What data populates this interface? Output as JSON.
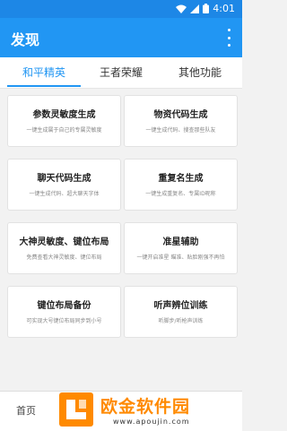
{
  "status_bar": {
    "time": "4:01"
  },
  "app_bar": {
    "title": "发现"
  },
  "tabs": [
    {
      "label": "和平精英",
      "active": true
    },
    {
      "label": "王者荣耀",
      "active": false
    },
    {
      "label": "其他功能",
      "active": false
    }
  ],
  "cards": [
    {
      "title": "参数灵敏度生成",
      "subtitle": "一键生成属于自己的专属灵敏度"
    },
    {
      "title": "物资代码生成",
      "subtitle": "一键生成代码、搜查那些队友"
    },
    {
      "title": "聊天代码生成",
      "subtitle": "一键生成代码、超大聊天字体"
    },
    {
      "title": "重复名生成",
      "subtitle": "一键生成重复名、专属ID昵称"
    },
    {
      "title": "大神灵敏度、键位布局",
      "subtitle": "免费查看大神灵敏度、键位布局"
    },
    {
      "title": "准星辅助",
      "subtitle": "一键开启准星 瞄准、贴脸刚强不再怕"
    },
    {
      "title": "键位布局备份",
      "subtitle": "可实现大号键位布局同步到小号"
    },
    {
      "title": "听声辨位训练",
      "subtitle": "听脚步/听枪声训练"
    }
  ],
  "bottom_nav": {
    "home_label": "首页"
  },
  "watermark": {
    "brand": "欧金软件园",
    "url": "www.apoujin.com"
  },
  "colors": {
    "primary": "#2196f3",
    "status_bar": "#1d87e6",
    "watermark": "#ff8a00"
  }
}
